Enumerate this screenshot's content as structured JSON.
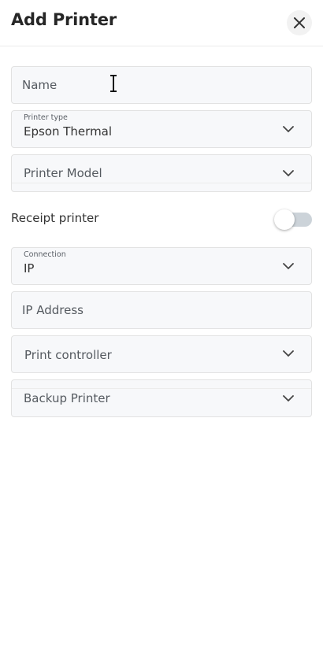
{
  "header": {
    "title": "Add Printer",
    "close_icon": "close-icon"
  },
  "form": {
    "name": {
      "placeholder": "Name",
      "value": ""
    },
    "printer_type": {
      "label": "Printer type",
      "value": "Epson Thermal"
    },
    "printer_model": {
      "placeholder": "Printer Model"
    },
    "receipt_printer": {
      "label": "Receipt printer",
      "enabled": false
    },
    "connection": {
      "label": "Connection",
      "value": "IP"
    },
    "ip_address": {
      "placeholder": "IP Address",
      "value": ""
    },
    "print_controller": {
      "placeholder": "Print controller"
    },
    "backup_printer": {
      "placeholder": "Backup Printer"
    }
  },
  "icons": {
    "dropdown": "chevron-down-icon",
    "text_cursor": "text-cursor-icon"
  },
  "colors": {
    "field_bg": "#f7f8fa",
    "field_border": "#e2e2e2",
    "toggle_off": "#ccd3d9"
  }
}
